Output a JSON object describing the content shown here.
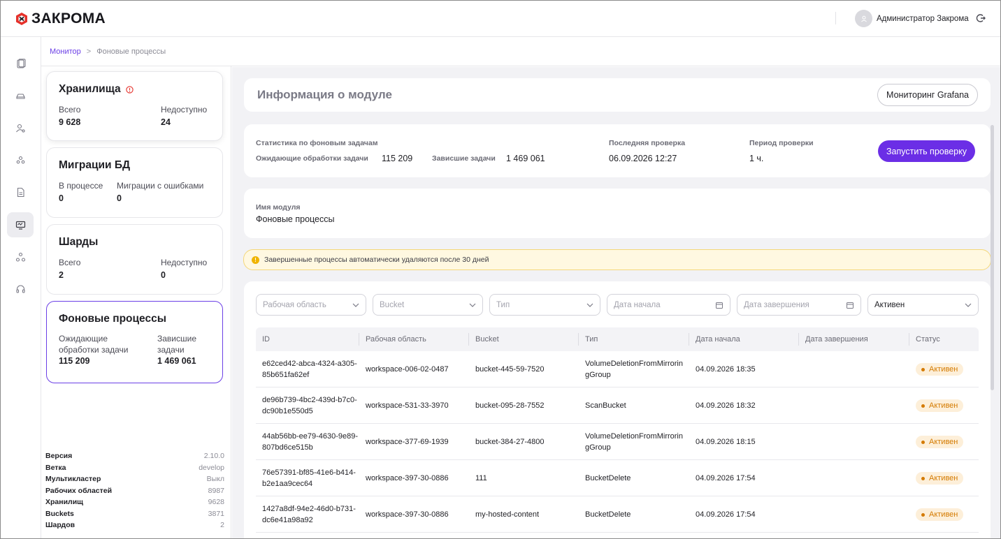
{
  "app": {
    "logo_text": "ЗАКРОМА",
    "user_name": "Администратор Закрома",
    "accent": "#6b2ee6"
  },
  "breadcrumb": {
    "link": "Монитор",
    "sep": ">",
    "current": "Фоновые процессы"
  },
  "rail": [
    "documents-icon",
    "storage-icon",
    "user-settings-icon",
    "users-icon",
    "file-icon",
    "monitor-icon",
    "cluster-icon",
    "support-icon"
  ],
  "cards": {
    "storage": {
      "title": "Хранилища",
      "l1": "Всего",
      "v1": "9 628",
      "l2": "Недоступно",
      "v2": "24"
    },
    "migrations": {
      "title": "Миграции БД",
      "l1": "В процессе",
      "v1": "0",
      "l2": "Миграции с ошибками",
      "v2": "0"
    },
    "shards": {
      "title": "Шарды",
      "l1": "Всего",
      "v1": "2",
      "l2": "Недоступно",
      "v2": "0"
    },
    "background": {
      "title": "Фоновые процессы",
      "l1a": "Ожидающие",
      "l1b": "обработки задачи",
      "v1": "115 209",
      "l2a": "Зависшие",
      "l2b": "задачи",
      "v2": "1 469 061"
    }
  },
  "info": [
    {
      "key": "Версия",
      "val": "2.10.0"
    },
    {
      "key": "Ветка",
      "val": "develop"
    },
    {
      "key": "Мультикластер",
      "val": "Выкл"
    },
    {
      "key": "Рабочих областей",
      "val": "8987"
    },
    {
      "key": "Хранилищ",
      "val": "9628"
    },
    {
      "key": "Buckets",
      "val": "3871"
    },
    {
      "key": "Шардов",
      "val": "2"
    }
  ],
  "module": {
    "title": "Информация о модуле",
    "grafana_button": "Мониторинг Grafana"
  },
  "stats": {
    "section_label": "Статистика по фоновым задачам",
    "pending_label": "Ожидающие обработки задачи",
    "pending_value": "115 209",
    "stuck_label": "Зависшие задачи",
    "stuck_value": "1 469 061",
    "last_check_label": "Последняя проверка",
    "last_check_value": "06.09.2026 12:27",
    "period_label": "Период проверки",
    "period_value": "1 ч.",
    "run_button": "Запустить проверку"
  },
  "module_name": {
    "label": "Имя модуля",
    "value": "Фоновые процессы"
  },
  "alert": {
    "text": "Завершенные процессы автоматически удаляются после 30 дней"
  },
  "filters": {
    "workspace": "Рабочая область",
    "bucket": "Bucket",
    "type": "Тип",
    "start_date": "Дата начала",
    "end_date": "Дата завершения",
    "status": "Активен"
  },
  "table": {
    "headers": [
      "ID",
      "Рабочая область",
      "Bucket",
      "Тип",
      "Дата начала",
      "Дата завершения",
      "Статус"
    ],
    "rows": [
      {
        "id": "e62ced42-abca-4324-a305-85b651fa62ef",
        "workspace": "workspace-006-02-0487",
        "bucket": "bucket-445-59-7520",
        "type": "VolumeDeletionFromMirroringGroup",
        "start": "04.09.2026 18:35",
        "end": "",
        "status": "Активен"
      },
      {
        "id": "de96b739-4bc2-439d-b7c0-dc90b1e550d5",
        "workspace": "workspace-531-33-3970",
        "bucket": "bucket-095-28-7552",
        "type": "ScanBucket",
        "start": "04.09.2026 18:32",
        "end": "",
        "status": "Активен"
      },
      {
        "id": "44ab56bb-ee79-4630-9e89-807bd6ce515b",
        "workspace": "workspace-377-69-1939",
        "bucket": "bucket-384-27-4800",
        "type": "VolumeDeletionFromMirroringGroup",
        "start": "04.09.2026 18:15",
        "end": "",
        "status": "Активен"
      },
      {
        "id": "76e57391-bf85-41e6-b414-b2e1aa9cec64",
        "workspace": "workspace-397-30-0886",
        "bucket": "111",
        "type": "BucketDelete",
        "start": "04.09.2026 17:54",
        "end": "",
        "status": "Активен"
      },
      {
        "id": "1427a8df-94e2-46d0-b731-dc6e41a98a92",
        "workspace": "workspace-397-30-0886",
        "bucket": "my-hosted-content",
        "type": "BucketDelete",
        "start": "04.09.2026 17:54",
        "end": "",
        "status": "Активен"
      }
    ]
  }
}
